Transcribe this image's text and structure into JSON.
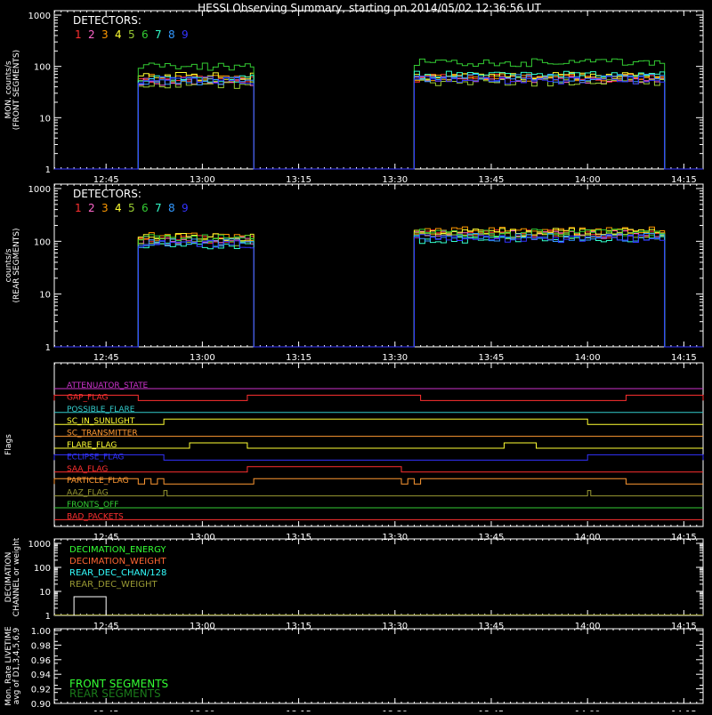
{
  "title": "HESSI Observing Summary, starting on 2014/05/02 12:36:56 UT",
  "time_ticks": [
    "12:45",
    "13:00",
    "13:15",
    "13:30",
    "13:45",
    "14:00",
    "14:15"
  ],
  "detectors": {
    "heading": "DETECTORS:",
    "numbers": [
      "1",
      "2",
      "3",
      "4",
      "5",
      "6",
      "7",
      "8",
      "9"
    ],
    "colors": [
      "#ff3030",
      "#ff66cc",
      "#ff9900",
      "#ffff33",
      "#99cc33",
      "#33cc33",
      "#33ffcc",
      "#3399ff",
      "#3333ff"
    ]
  },
  "chart_data": [
    {
      "type": "line",
      "ylabel": "MON. counts/s (FRONT SEGMENTS)",
      "ylabel_lines": [
        "MON. counts/s",
        "(FRONT SEGMENTS)"
      ],
      "yscale": "log",
      "ylim": [
        1,
        1000
      ],
      "y_ticks": [
        "1",
        "10",
        "100",
        "1000"
      ],
      "x_range": [
        "12:36:56",
        "14:18:00"
      ],
      "segments": [
        {
          "start": "12:50",
          "end": "13:08"
        },
        {
          "start": "13:33",
          "end": "14:12"
        }
      ],
      "series": [
        {
          "detector": "1",
          "level_seg1": 55,
          "level_seg2": 60
        },
        {
          "detector": "2",
          "level_seg1": 50,
          "level_seg2": 55
        },
        {
          "detector": "3",
          "level_seg1": 60,
          "level_seg2": 62
        },
        {
          "detector": "4",
          "level_seg1": 65,
          "level_seg2": 65
        },
        {
          "detector": "5",
          "level_seg1": 45,
          "level_seg2": 50
        },
        {
          "detector": "6",
          "level_seg1": 100,
          "level_seg2": 120
        },
        {
          "detector": "7",
          "level_seg1": 58,
          "level_seg2": 70
        },
        {
          "detector": "8",
          "level_seg1": 52,
          "level_seg2": 60
        },
        {
          "detector": "9",
          "level_seg1": 55,
          "level_seg2": 55
        }
      ]
    },
    {
      "type": "line",
      "ylabel": "counts/s (REAR SEGMENTS)",
      "ylabel_lines": [
        "counts/s",
        "(REAR SEGMENTS)"
      ],
      "yscale": "log",
      "ylim": [
        1,
        1000
      ],
      "y_ticks": [
        "1",
        "10",
        "100",
        "1000"
      ],
      "x_range": [
        "12:36:56",
        "14:18:00"
      ],
      "segments": [
        {
          "start": "12:50",
          "end": "13:08"
        },
        {
          "start": "13:33",
          "end": "14:12"
        }
      ],
      "series": [
        {
          "detector": "1",
          "level_seg1": 110,
          "level_seg2": 140
        },
        {
          "detector": "2",
          "level_seg1": 105,
          "level_seg2": 135
        },
        {
          "detector": "3",
          "level_seg1": 125,
          "level_seg2": 160
        },
        {
          "detector": "4",
          "level_seg1": 120,
          "level_seg2": 150
        },
        {
          "detector": "5",
          "level_seg1": 100,
          "level_seg2": 130
        },
        {
          "detector": "6",
          "level_seg1": 115,
          "level_seg2": 145
        },
        {
          "detector": "7",
          "level_seg1": 85,
          "level_seg2": 110
        },
        {
          "detector": "8",
          "level_seg1": 95,
          "level_seg2": 120
        },
        {
          "detector": "9",
          "level_seg1": 90,
          "level_seg2": 115
        }
      ]
    },
    {
      "type": "line",
      "ylabel": "Flags",
      "flags": [
        {
          "name": "ATTENUATOR_STATE",
          "color": "#cc33cc",
          "high": []
        },
        {
          "name": "GAP_FLAG",
          "color": "#ff3030",
          "high": [
            [
              "12:36:56",
              "12:50"
            ],
            [
              "13:07",
              "13:34"
            ],
            [
              "14:06",
              "14:18"
            ]
          ]
        },
        {
          "name": "POSSIBLE_FLARE",
          "color": "#33cccc",
          "high": []
        },
        {
          "name": "SC_IN_SUNLIGHT",
          "color": "#ffff33",
          "high": [
            [
              "12:54",
              "14:00"
            ]
          ]
        },
        {
          "name": "SC_TRANSMITTER",
          "color": "#ff9933",
          "high": []
        },
        {
          "name": "FLARE_FLAG",
          "color": "#ffff33",
          "high": [
            [
              "12:58",
              "13:07"
            ],
            [
              "13:47",
              "13:52"
            ]
          ]
        },
        {
          "name": "ECLIPSE_FLAG",
          "color": "#3333ff",
          "high": [
            [
              "12:36:56",
              "12:54"
            ],
            [
              "14:00",
              "14:18"
            ]
          ]
        },
        {
          "name": "SAA_FLAG",
          "color": "#ff3030",
          "high": [
            [
              "13:07",
              "13:31"
            ]
          ]
        },
        {
          "name": "PARTICLE_FLAG",
          "color": "#ff9933",
          "high": [
            [
              "12:36:56",
              "12:50"
            ],
            [
              "12:51",
              "12:52"
            ],
            [
              "12:53",
              "12:54"
            ],
            [
              "13:08",
              "13:31"
            ],
            [
              "13:32",
              "13:33"
            ],
            [
              "13:34",
              "14:06"
            ]
          ]
        },
        {
          "name": "AAZ_FLAG",
          "color": "#999933",
          "high": [
            [
              "12:54",
              "12:54:30"
            ],
            [
              "14:00",
              "14:00:30"
            ]
          ]
        },
        {
          "name": "FRONTS_OFF",
          "color": "#33cc33",
          "high": []
        },
        {
          "name": "BAD_PACKETS",
          "color": "#ff3030",
          "high": []
        }
      ]
    },
    {
      "type": "line",
      "ylabel": "DECIMATION CHANNEL or weight",
      "ylabel_lines": [
        "DECIMATION",
        "CHANNEL or weight"
      ],
      "yscale": "log",
      "ylim": [
        1,
        1000
      ],
      "y_ticks": [
        "1",
        "10",
        "100",
        "1000"
      ],
      "series": [
        {
          "name": "DECIMATION_ENERGY",
          "color": "#33ff33",
          "value": 1
        },
        {
          "name": "DECIMATION_WEIGHT",
          "color": "#ff6633",
          "value": 1
        },
        {
          "name": "REAR_DEC_CHAN/128",
          "color": "#33ffff",
          "value": 1
        },
        {
          "name": "REAR_DEC_WEIGHT",
          "color": "#999933",
          "value": 1
        }
      ],
      "box_range": [
        "12:40",
        "12:45"
      ],
      "box_value": 6
    },
    {
      "type": "line",
      "ylabel": "Mon. Rate LIVETIME avg of D1,3,4,5,6,9",
      "ylabel_lines": [
        "Mon. Rate LIVETIME",
        "avg of D1,3,4,5,6,9"
      ],
      "ylim": [
        0.9,
        1.0
      ],
      "y_ticks": [
        "0.90",
        "0.92",
        "0.94",
        "0.96",
        "0.98",
        "1.00"
      ],
      "series": [
        {
          "name": "FRONT SEGMENTS",
          "color": "#33ff33"
        },
        {
          "name": "REAR SEGMENTS",
          "color": "#1a7a1a"
        }
      ]
    }
  ]
}
